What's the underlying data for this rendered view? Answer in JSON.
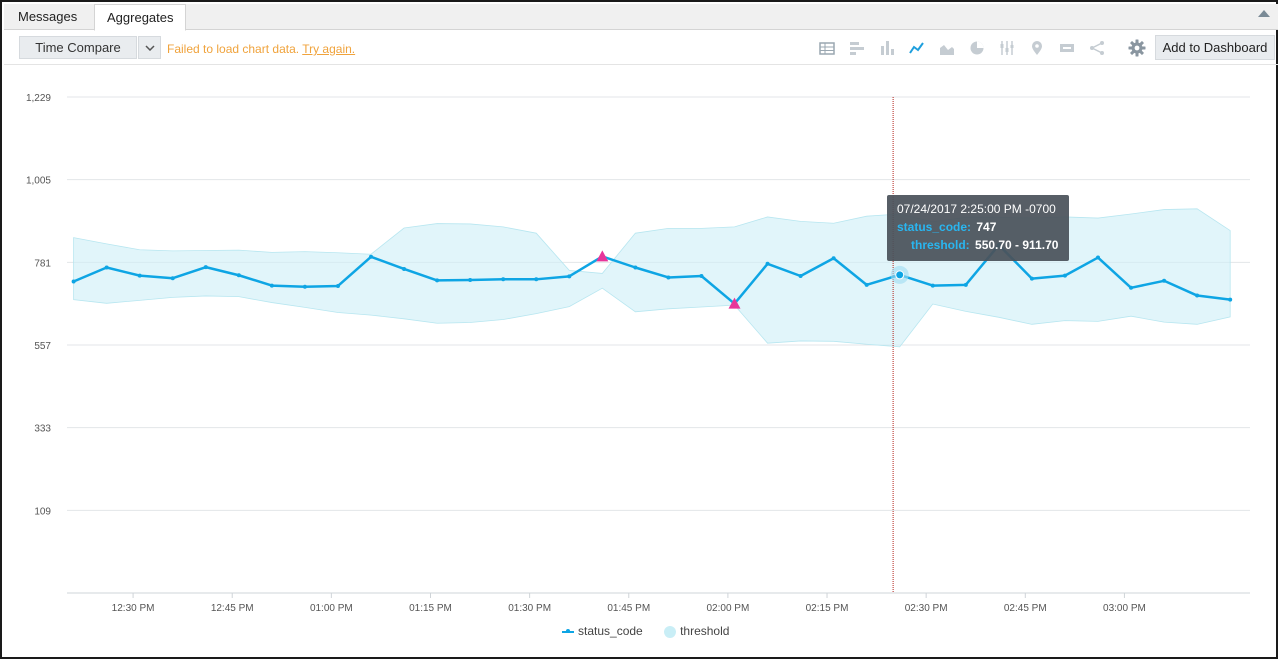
{
  "tabs": [
    {
      "label": "Messages",
      "active": false
    },
    {
      "label": "Aggregates",
      "active": true
    }
  ],
  "toolbar": {
    "time_compare_label": "Time Compare",
    "error_text": "Failed to load chart data.",
    "retry_label": "Try again.",
    "add_dashboard_label": "Add to Dashboard",
    "icons": [
      "table-icon",
      "bar-chart-icon",
      "column-chart-icon",
      "line-chart-icon",
      "area-chart-icon",
      "pie-chart-icon",
      "box-plot-icon",
      "map-marker-icon",
      "single-value-icon",
      "sankey-icon",
      "settings-icon"
    ],
    "active_icon": "line-chart-icon"
  },
  "tooltip": {
    "title": "07/24/2017 2:25:00 PM -0700",
    "series1_label": "status_code:",
    "series1_value": "747",
    "series2_label": "threshold:",
    "series2_value": "550.70 - 911.70"
  },
  "chart_data": {
    "type": "line",
    "x_tick_labels": [
      "12:30 PM",
      "12:45 PM",
      "01:00 PM",
      "01:15 PM",
      "01:30 PM",
      "01:45 PM",
      "02:00 PM",
      "02:15 PM",
      "02:30 PM",
      "02:45 PM",
      "03:00 PM"
    ],
    "x_tick_minutes": [
      30,
      45,
      60,
      75,
      90,
      105,
      120,
      135,
      150,
      165,
      180
    ],
    "x_range_minutes": [
      20,
      199
    ],
    "y_ticks": [
      109,
      333,
      557,
      781,
      1005,
      1229
    ],
    "y_tick_labels": [
      "109",
      "333",
      "557",
      "781",
      "1,005",
      "1,229"
    ],
    "ylim": [
      -115,
      1229
    ],
    "grid": true,
    "legend_position": "bottom-center",
    "colors": {
      "status_code": "#0ea5e4",
      "threshold": "#cdeff6",
      "outlier": "#e7359a",
      "crosshair": "#b3221b"
    },
    "x_minutes": [
      21,
      26,
      31,
      36,
      41,
      46,
      51,
      56,
      61,
      66,
      71,
      76,
      81,
      86,
      91,
      96,
      101,
      106,
      111,
      116,
      121,
      126,
      131,
      136,
      141,
      146,
      151,
      156,
      161,
      166,
      171,
      176,
      181,
      186,
      191,
      196
    ],
    "series": [
      {
        "name": "status_code",
        "values": [
          729,
          767,
          745,
          738,
          768,
          746,
          718,
          715,
          717,
          796,
          763,
          732,
          733,
          735,
          735,
          743,
          797,
          767,
          740,
          744,
          669,
          777,
          744,
          792,
          720,
          747,
          718,
          720,
          828,
          737,
          745,
          794,
          712,
          731,
          691,
          680
        ]
      },
      {
        "name": "threshold",
        "lower": [
          680,
          670,
          678,
          686,
          690,
          688,
          672,
          659,
          645,
          638,
          628,
          616,
          618,
          626,
          642,
          661,
          711,
          647,
          655,
          660,
          665,
          562,
          568,
          567,
          559,
          552,
          668,
          648,
          632,
          613,
          623,
          621,
          635,
          619,
          613,
          633
        ],
        "upper": [
          848,
          831,
          815,
          812,
          813,
          814,
          808,
          810,
          807,
          803,
          874,
          886,
          885,
          877,
          860,
          759,
          751,
          860,
          873,
          873,
          877,
          904,
          892,
          887,
          906,
          912,
          891,
          903,
          903,
          901,
          904,
          901,
          912,
          924,
          926,
          867
        ]
      }
    ],
    "outliers_x": [
      101,
      121
    ],
    "outliers_y": [
      797,
      669
    ],
    "highlight_x": 146,
    "highlight_y": 747,
    "crosshair_x": 145
  }
}
